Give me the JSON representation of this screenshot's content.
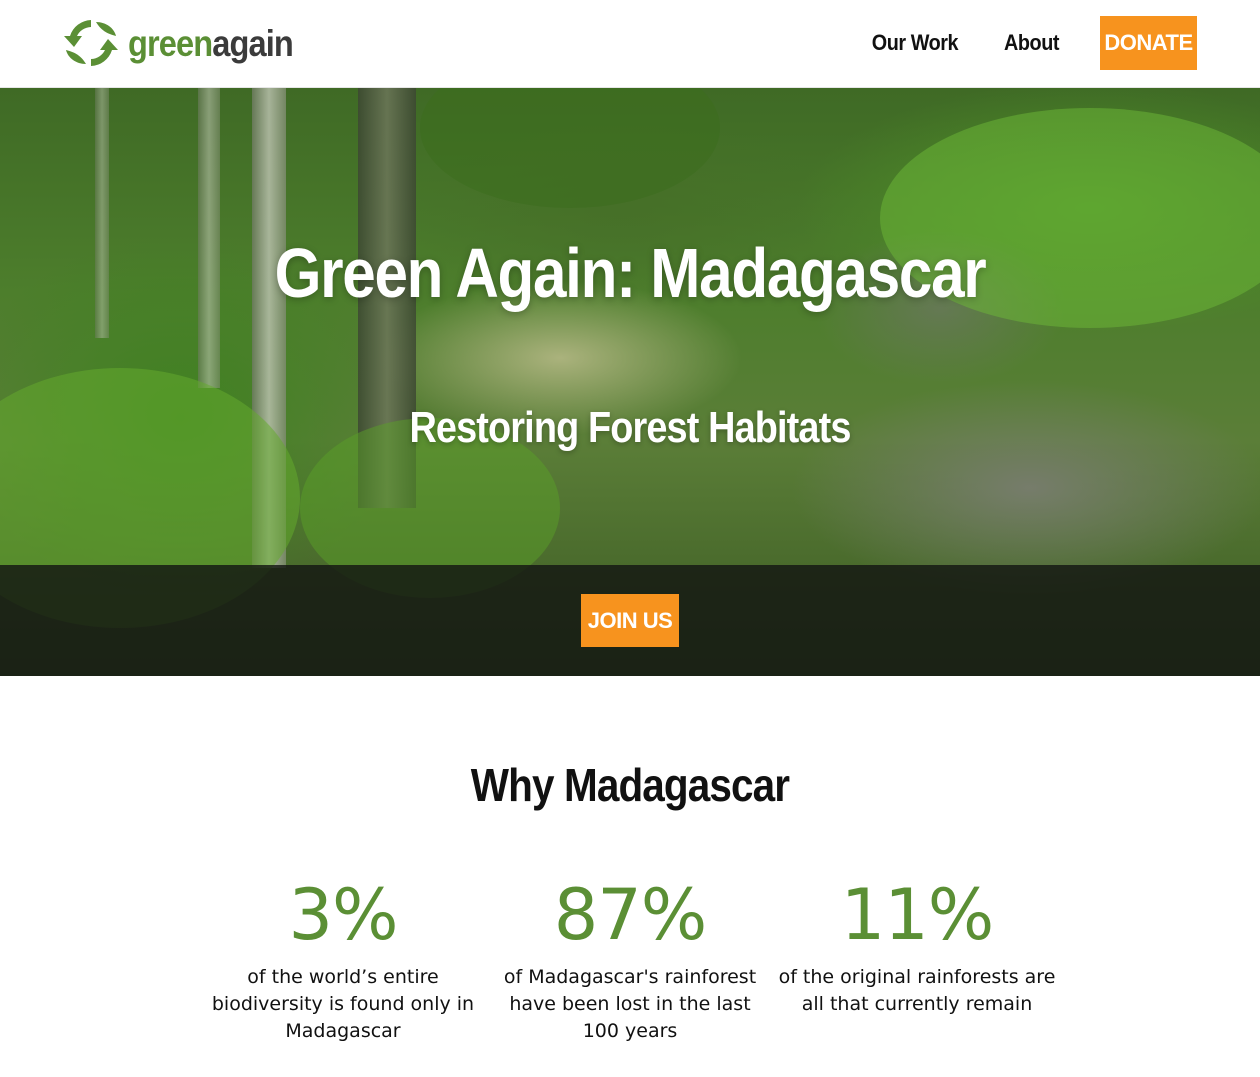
{
  "header": {
    "logo": {
      "text_green": "green",
      "text_dark": "again",
      "icon": "recycle-leaf-icon"
    },
    "nav": [
      {
        "label": "Our Work"
      },
      {
        "label": "About"
      }
    ],
    "donate_label": "DONATE"
  },
  "hero": {
    "title": "Green Again: Madagascar",
    "subtitle": "Restoring Forest Habitats",
    "join_label": "JOIN US"
  },
  "why": {
    "title": "Why Madagascar",
    "stats": [
      {
        "value": "3%",
        "description": "of the world’s entire biodiversity is found only in Madagascar"
      },
      {
        "value": "87%",
        "description": "of Madagascar's rainforest have been lost in the last 100 years"
      },
      {
        "value": "11%",
        "description": "of the original rainforests are all that currently remain"
      }
    ]
  },
  "colors": {
    "brand_green": "#5b8f35",
    "accent_orange": "#f7931e"
  }
}
